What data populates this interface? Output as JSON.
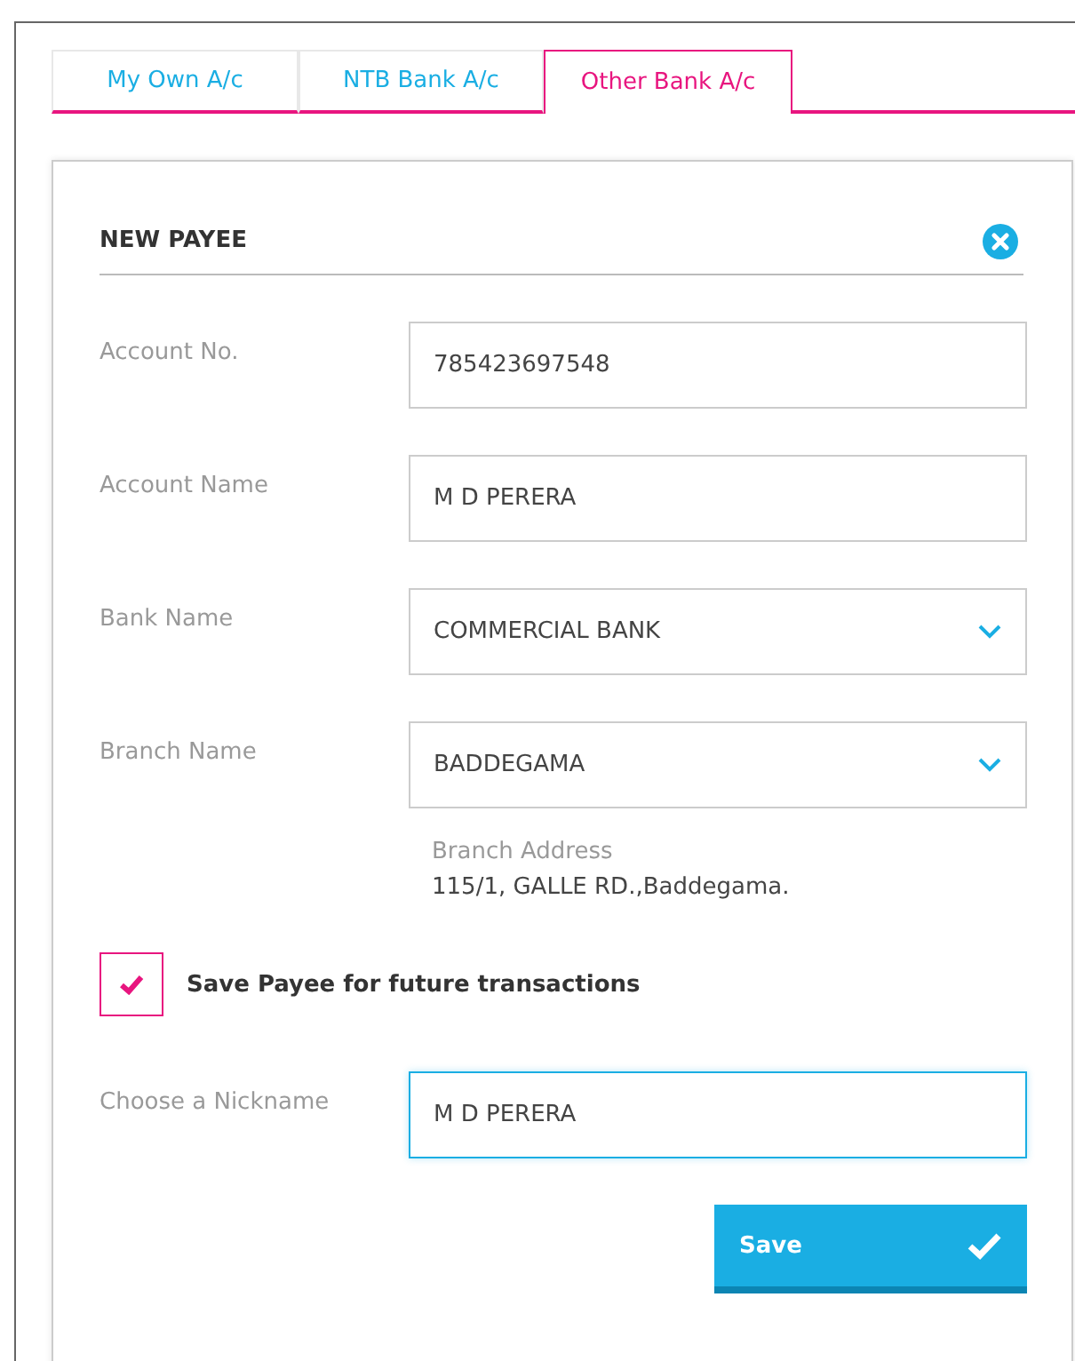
{
  "tabs": [
    {
      "label": "My Own A/c",
      "selected": false
    },
    {
      "label": "NTB Bank A/c",
      "selected": false
    },
    {
      "label": "Other Bank A/c",
      "selected": true
    }
  ],
  "panel": {
    "title": "NEW PAYEE",
    "fields": [
      {
        "label": "Account No.",
        "kind": "text",
        "value": "785423697548",
        "focused": false
      },
      {
        "label": "Account Name",
        "kind": "text",
        "value": "M D PERERA",
        "focused": false
      },
      {
        "label": "Bank Name",
        "kind": "select",
        "value": "COMMERCIAL BANK",
        "focused": false
      },
      {
        "label": "Branch Name",
        "kind": "select",
        "value": "BADDEGAMA",
        "focused": false
      }
    ],
    "branch_address": {
      "label": "Branch Address",
      "value": "115/1, GALLE RD.,Baddegama."
    },
    "save_payee": {
      "label": "Save Payee for future transactions",
      "checked": true
    },
    "nickname": {
      "label": "Choose a Nickname",
      "value": "M D PERERA",
      "focused": true
    },
    "save_button": "Save"
  }
}
